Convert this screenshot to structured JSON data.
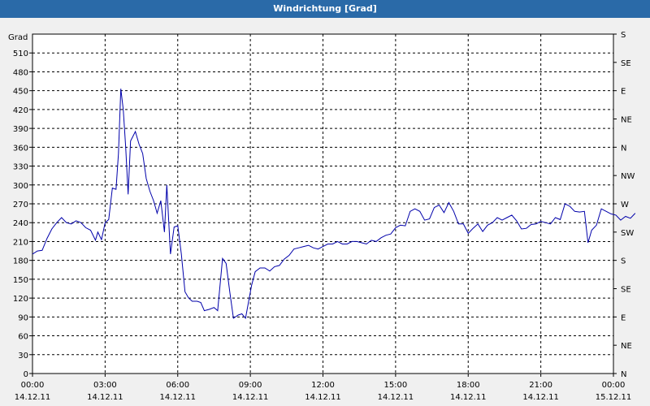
{
  "window": {
    "title": "Windrichtung [Grad]"
  },
  "chart_data": {
    "type": "line",
    "title": "Windrichtung [Grad]",
    "ylabel": "Grad",
    "xlabel": "",
    "ylim": [
      0,
      540
    ],
    "xlim_hours": [
      0,
      24
    ],
    "grid": true,
    "y_ticks": [
      0,
      30,
      60,
      90,
      120,
      150,
      180,
      210,
      240,
      270,
      300,
      330,
      360,
      390,
      420,
      450,
      480,
      510
    ],
    "right_axis_ticks": [
      {
        "value": 0,
        "label": "N"
      },
      {
        "value": 45,
        "label": "NE"
      },
      {
        "value": 90,
        "label": "E"
      },
      {
        "value": 135,
        "label": "SE"
      },
      {
        "value": 180,
        "label": "S"
      },
      {
        "value": 225,
        "label": "SW"
      },
      {
        "value": 270,
        "label": "W"
      },
      {
        "value": 315,
        "label": "NW"
      },
      {
        "value": 360,
        "label": "N"
      },
      {
        "value": 405,
        "label": "NE"
      },
      {
        "value": 450,
        "label": "E"
      },
      {
        "value": 495,
        "label": "SE"
      },
      {
        "value": 540,
        "label": "S"
      }
    ],
    "x_ticks": [
      {
        "time": "00:00",
        "date": "14.12.11"
      },
      {
        "time": "03:00",
        "date": "14.12.11"
      },
      {
        "time": "06:00",
        "date": "14.12.11"
      },
      {
        "time": "09:00",
        "date": "14.12.11"
      },
      {
        "time": "12:00",
        "date": "14.12.11"
      },
      {
        "time": "15:00",
        "date": "14.12.11"
      },
      {
        "time": "18:00",
        "date": "14.12.11"
      },
      {
        "time": "21:00",
        "date": "14.12.11"
      },
      {
        "time": "00:00",
        "date": "15.12.11"
      }
    ],
    "series": [
      {
        "color": "#0000aa",
        "points": [
          [
            0.0,
            190
          ],
          [
            0.2,
            195
          ],
          [
            0.4,
            196
          ],
          [
            0.6,
            215
          ],
          [
            0.8,
            230
          ],
          [
            1.0,
            240
          ],
          [
            1.2,
            248
          ],
          [
            1.4,
            240
          ],
          [
            1.6,
            238
          ],
          [
            1.8,
            243
          ],
          [
            2.0,
            240
          ],
          [
            2.2,
            232
          ],
          [
            2.4,
            228
          ],
          [
            2.6,
            212
          ],
          [
            2.7,
            225
          ],
          [
            2.85,
            213
          ],
          [
            3.0,
            240
          ],
          [
            3.15,
            245
          ],
          [
            3.3,
            295
          ],
          [
            3.45,
            293
          ],
          [
            3.55,
            350
          ],
          [
            3.65,
            453
          ],
          [
            3.75,
            420
          ],
          [
            3.85,
            360
          ],
          [
            3.95,
            285
          ],
          [
            4.05,
            370
          ],
          [
            4.25,
            385
          ],
          [
            4.4,
            365
          ],
          [
            4.55,
            350
          ],
          [
            4.7,
            310
          ],
          [
            4.85,
            290
          ],
          [
            5.0,
            275
          ],
          [
            5.15,
            255
          ],
          [
            5.3,
            275
          ],
          [
            5.45,
            225
          ],
          [
            5.55,
            300
          ],
          [
            5.7,
            190
          ],
          [
            5.85,
            233
          ],
          [
            6.0,
            235
          ],
          [
            6.15,
            190
          ],
          [
            6.3,
            130
          ],
          [
            6.45,
            120
          ],
          [
            6.6,
            115
          ],
          [
            6.8,
            115
          ],
          [
            6.95,
            113
          ],
          [
            7.1,
            100
          ],
          [
            7.3,
            102
          ],
          [
            7.5,
            105
          ],
          [
            7.65,
            100
          ],
          [
            7.85,
            183
          ],
          [
            8.0,
            175
          ],
          [
            8.15,
            130
          ],
          [
            8.3,
            88
          ],
          [
            8.5,
            93
          ],
          [
            8.65,
            95
          ],
          [
            8.8,
            88
          ],
          [
            9.05,
            140
          ],
          [
            9.2,
            162
          ],
          [
            9.4,
            168
          ],
          [
            9.6,
            168
          ],
          [
            9.8,
            163
          ],
          [
            10.0,
            170
          ],
          [
            10.2,
            172
          ],
          [
            10.4,
            182
          ],
          [
            10.6,
            188
          ],
          [
            10.8,
            198
          ],
          [
            11.0,
            200
          ],
          [
            11.2,
            202
          ],
          [
            11.4,
            204
          ],
          [
            11.6,
            200
          ],
          [
            11.8,
            198
          ],
          [
            12.0,
            202
          ],
          [
            12.2,
            206
          ],
          [
            12.4,
            206
          ],
          [
            12.6,
            210
          ],
          [
            12.8,
            206
          ],
          [
            13.0,
            206
          ],
          [
            13.2,
            210
          ],
          [
            13.4,
            210
          ],
          [
            13.6,
            208
          ],
          [
            13.8,
            206
          ],
          [
            14.0,
            212
          ],
          [
            14.2,
            210
          ],
          [
            14.4,
            216
          ],
          [
            14.6,
            220
          ],
          [
            14.8,
            222
          ],
          [
            15.0,
            232
          ],
          [
            15.2,
            236
          ],
          [
            15.4,
            235
          ],
          [
            15.6,
            258
          ],
          [
            15.8,
            262
          ],
          [
            16.0,
            258
          ],
          [
            16.2,
            244
          ],
          [
            16.4,
            246
          ],
          [
            16.6,
            264
          ],
          [
            16.8,
            268
          ],
          [
            17.0,
            256
          ],
          [
            17.2,
            272
          ],
          [
            17.4,
            258
          ],
          [
            17.6,
            238
          ],
          [
            17.8,
            238
          ],
          [
            18.0,
            223
          ],
          [
            18.2,
            231
          ],
          [
            18.4,
            238
          ],
          [
            18.6,
            226
          ],
          [
            18.8,
            236
          ],
          [
            19.0,
            240
          ],
          [
            19.2,
            248
          ],
          [
            19.4,
            244
          ],
          [
            19.6,
            248
          ],
          [
            19.8,
            252
          ],
          [
            20.0,
            243
          ],
          [
            20.2,
            230
          ],
          [
            20.4,
            231
          ],
          [
            20.6,
            237
          ],
          [
            20.8,
            238
          ],
          [
            21.0,
            242
          ],
          [
            21.2,
            240
          ],
          [
            21.4,
            238
          ],
          [
            21.6,
            248
          ],
          [
            21.8,
            245
          ],
          [
            22.0,
            270
          ],
          [
            22.2,
            266
          ],
          [
            22.4,
            258
          ],
          [
            22.6,
            257
          ],
          [
            22.8,
            258
          ],
          [
            22.95,
            208
          ],
          [
            23.1,
            228
          ],
          [
            23.3,
            236
          ],
          [
            23.5,
            262
          ],
          [
            23.7,
            258
          ],
          [
            23.9,
            254
          ],
          [
            24.1,
            252
          ],
          [
            24.3,
            244
          ],
          [
            24.5,
            250
          ],
          [
            24.7,
            247
          ],
          [
            24.9,
            255
          ]
        ]
      }
    ]
  }
}
